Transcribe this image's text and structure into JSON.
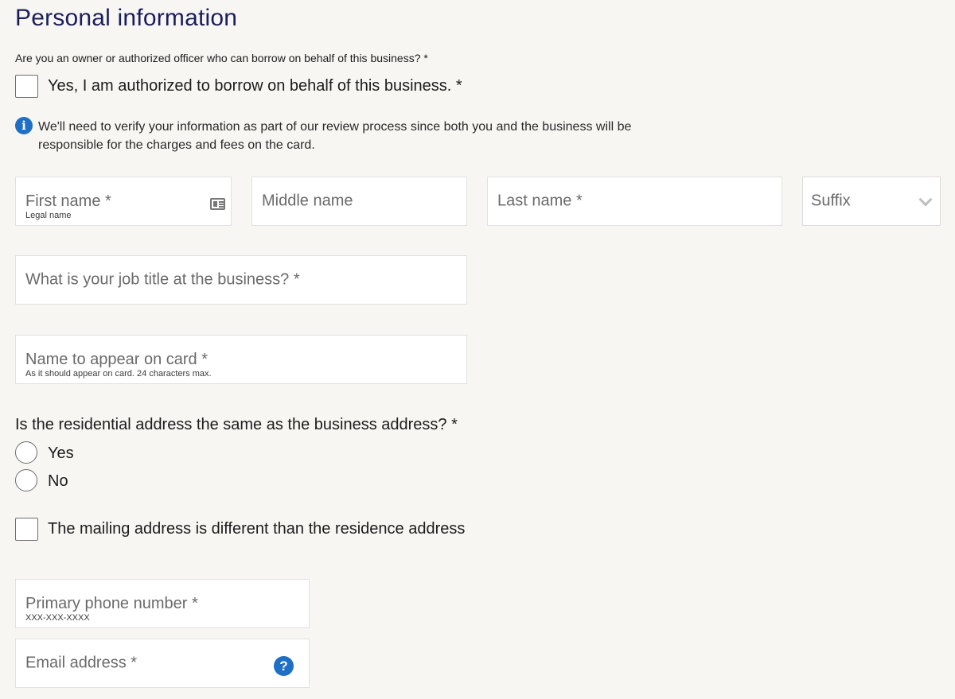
{
  "section": {
    "title": "Personal information"
  },
  "authorization": {
    "question": "Are you an owner or authorized officer who can borrow on behalf of this business? *",
    "checkbox_label": "Yes, I am authorized to borrow on behalf of this business. *"
  },
  "info_notice": {
    "text": "We'll need to verify your information as part of our review process since both you and the business will be responsible for the charges and fees on the card."
  },
  "name_fields": {
    "first_name": {
      "label": "First name *",
      "hint": "Legal name"
    },
    "middle_name": {
      "label": "Middle name"
    },
    "last_name": {
      "label": "Last name *"
    },
    "suffix": {
      "label": "Suffix"
    }
  },
  "job_title": {
    "label": "What is your job title at the business? *"
  },
  "card_name": {
    "label": "Name to appear on card *",
    "hint": "As it should appear on card. 24 characters max."
  },
  "residential": {
    "question": "Is the residential address the same as the business address? *",
    "options": [
      "Yes",
      "No"
    ]
  },
  "mailing": {
    "checkbox_label": "The mailing address is different than the residence address"
  },
  "phone": {
    "label": "Primary phone number *",
    "hint": "XXX-XXX-XXXX"
  },
  "email": {
    "label": "Email address *",
    "help_icon": "?"
  },
  "colors": {
    "title": "#1b1e5c",
    "accent_blue": "#1e6fc6",
    "background": "#f7f6f3",
    "field_bg": "#ffffff",
    "placeholder": "#6a6a6a"
  },
  "icons": {
    "info": "info-icon",
    "id_card": "id-card-icon",
    "chevron": "chevron-down-icon",
    "help": "help-icon"
  }
}
